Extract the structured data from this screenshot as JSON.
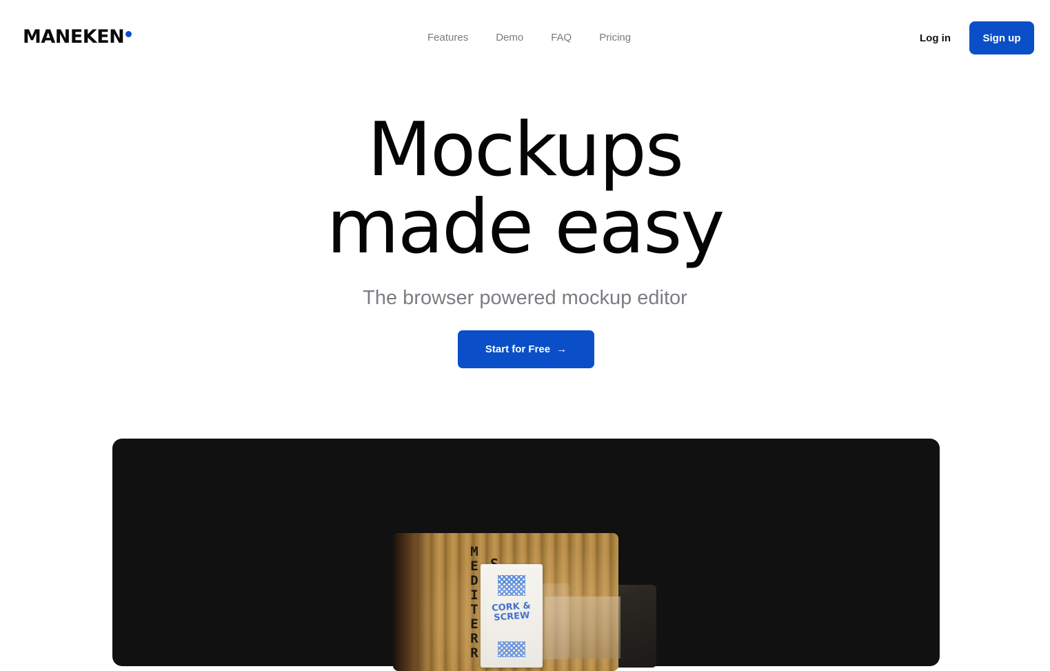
{
  "brand": {
    "name": "MANEKEN",
    "accent_color": "#0a4fc7"
  },
  "nav": {
    "items": [
      {
        "label": "Features"
      },
      {
        "label": "Demo"
      },
      {
        "label": "FAQ"
      },
      {
        "label": "Pricing"
      }
    ],
    "login_label": "Log in",
    "signup_label": "Sign up"
  },
  "hero": {
    "title_line1": "Mockups",
    "title_line2": "made easy",
    "subtitle": "The browser powered mockup editor",
    "cta_label": "Start for Free",
    "cta_icon": "arrow-right-icon",
    "cta_arrow": "→"
  },
  "showcase": {
    "background_color": "#111111",
    "image_vertical_text": "MEDITERR",
    "image_letter": "S",
    "poster_text": "CORK & SCREW"
  }
}
